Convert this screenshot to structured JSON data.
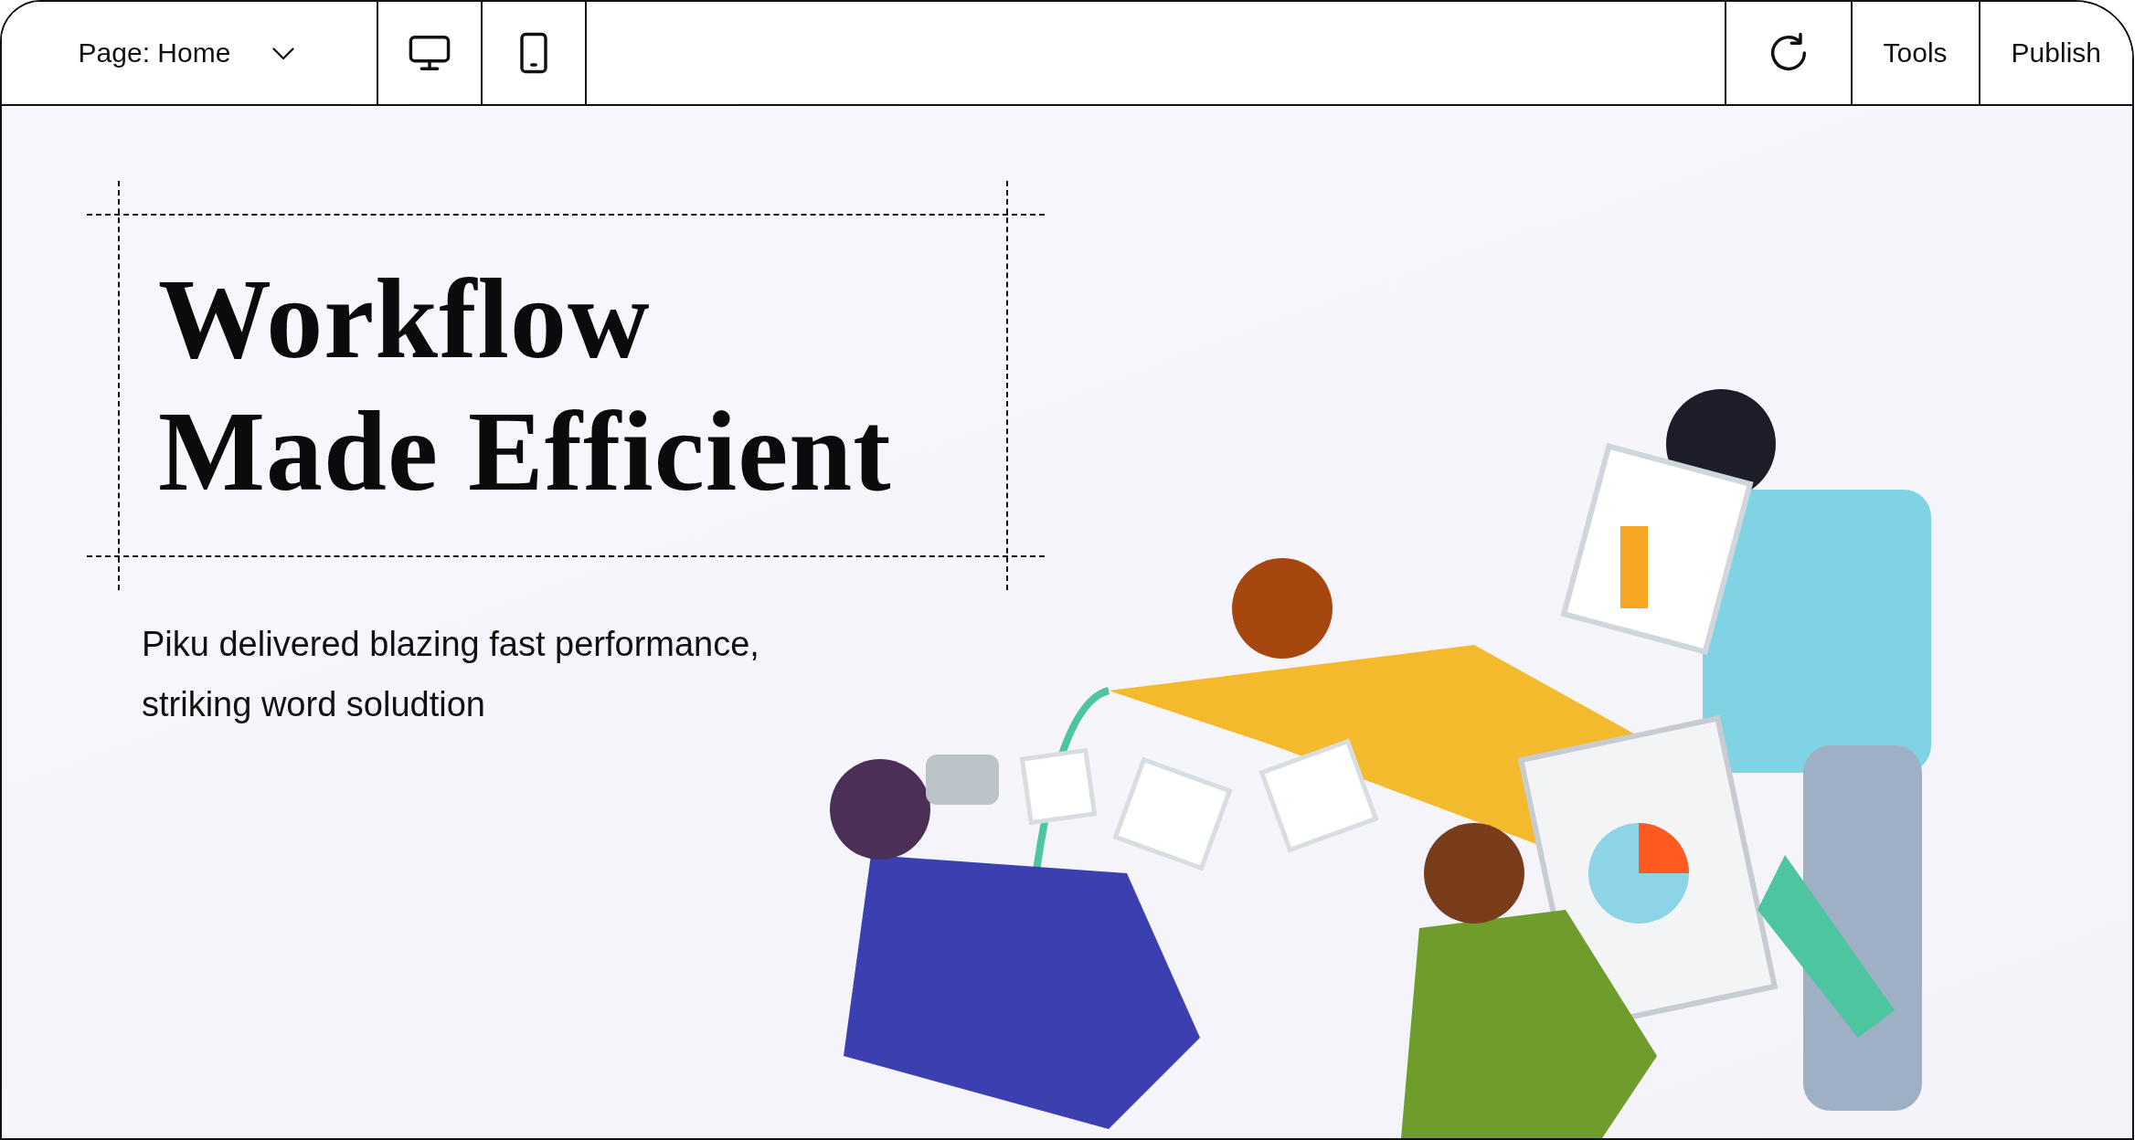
{
  "toolbar": {
    "page_selector": {
      "label": "Page: Home"
    },
    "device_buttons": [
      {
        "kind": "desktop"
      },
      {
        "kind": "mobile"
      }
    ],
    "actions": [
      {
        "kind": "refresh"
      },
      {
        "kind": "text",
        "label": "Tools"
      },
      {
        "kind": "text",
        "label": "Publish"
      }
    ]
  },
  "hero": {
    "heading_lines": [
      "Workflow",
      "Made Efficient"
    ],
    "subtitle": "Piku delivered blazing fast performance, striking word soludtion"
  }
}
